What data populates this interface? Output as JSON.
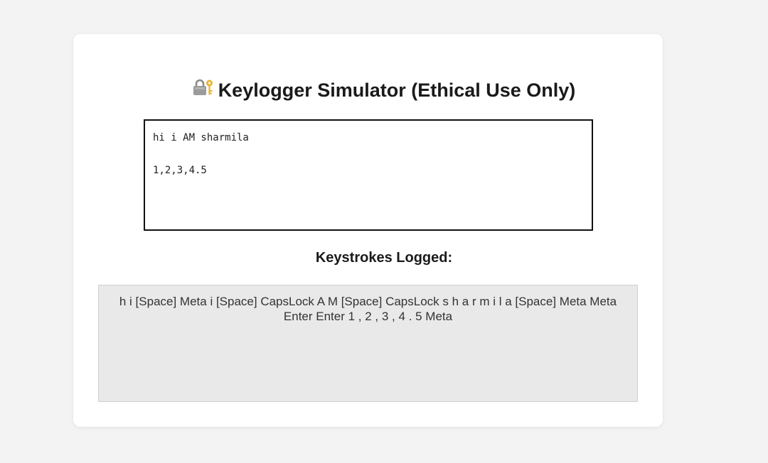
{
  "page": {
    "title": "Keylogger Simulator (Ethical Use Only)",
    "title_icon": "lock-with-key-icon"
  },
  "input": {
    "value": "hi i AM sharmila\n\n1,2,3,4.5"
  },
  "log": {
    "heading": "Keystrokes Logged:",
    "content": "h i [Space] Meta i [Space] CapsLock A M [Space] CapsLock s h a r m i l a [Space] Meta Meta Enter Enter 1 , 2 , 3 , 4 . 5 Meta"
  },
  "colors": {
    "page_background": "#f3f3f3",
    "card_background": "#ffffff",
    "log_background": "#e9e9e9",
    "text": "#1a1a1a"
  }
}
